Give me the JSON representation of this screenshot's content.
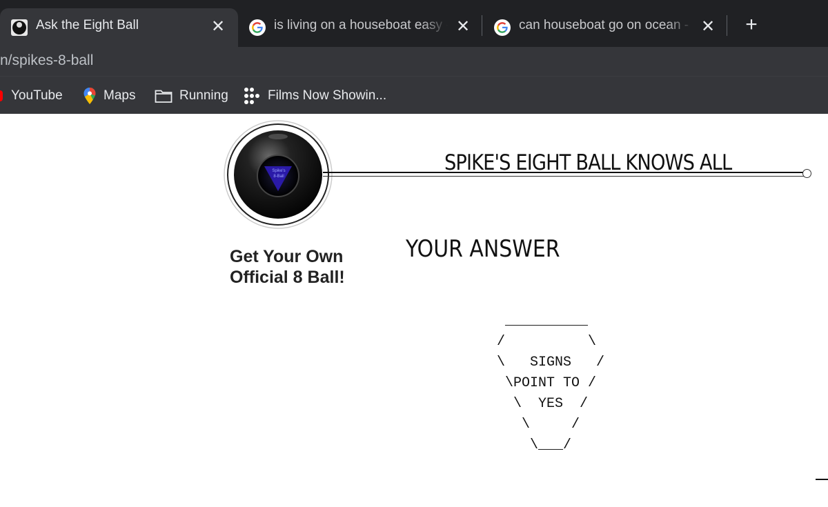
{
  "browser": {
    "tabs": [
      {
        "title": "Ask the Eight Ball",
        "favicon": "eight-ball-icon",
        "active": true
      },
      {
        "title": "is living on a houseboat easy - Google Search",
        "favicon": "google-icon",
        "active": false
      },
      {
        "title": "can houseboat go on ocean - Google Search",
        "favicon": "google-icon",
        "active": false
      }
    ],
    "url": "n/spikes-8-ball",
    "bookmarks": [
      {
        "label": "YouTube",
        "icon": "youtube-icon"
      },
      {
        "label": "Maps",
        "icon": "maps-icon"
      },
      {
        "label": "Running",
        "icon": "folder-icon"
      },
      {
        "label": "Films Now Showin...",
        "icon": "dots-grid-icon"
      }
    ],
    "close_glyph": "✕",
    "new_tab_glyph": "+"
  },
  "page": {
    "title": "SPIKE'S EIGHT BALL KNOWS ALL",
    "ball_label": "Spike's 8-Ball",
    "promo": "Get Your Own Official 8 Ball!",
    "answer_heading": "YOUR ANSWER",
    "answer_ascii": "  __________\n /          \\\n \\   SIGNS   /\n  \\POINT TO /\n   \\  YES  /\n    \\     /\n     \\___/",
    "answer": "SIGNS POINT TO YES"
  },
  "colors": {
    "chrome_dark": "#202124",
    "chrome_tab": "#35363a",
    "text_light": "#e8eaed",
    "triangle": "#2a1aa8"
  }
}
